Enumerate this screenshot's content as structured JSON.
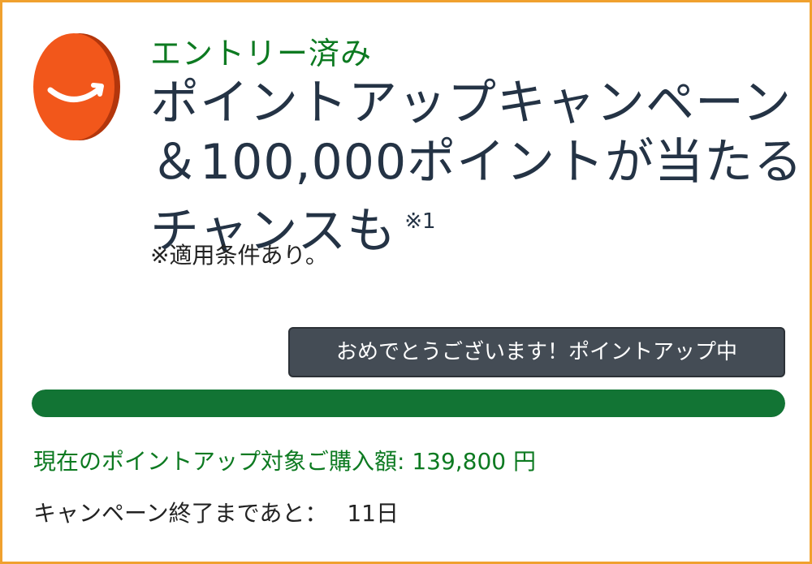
{
  "entry_status": "エントリー済み",
  "title_lines": [
    "ポイントアップキャンペーン",
    "＆100,000ポイントが当たる",
    "チャンスも"
  ],
  "title_footnote_mark": "※1",
  "terms_note": "※適用条件あり。",
  "congrats_banner": "おめでとうございます！ポイントアップ中",
  "progress": {
    "fraction": 1.0
  },
  "purchase_amount_text": "現在のポイントアップ対象ご購入額: 139,800 円",
  "campaign_end_label": "キャンペーン終了まであと：",
  "campaign_days_left": "11日",
  "icons": {
    "logo": "amazon-smile-coin-icon"
  },
  "colors": {
    "border": "#f0a12e",
    "coin": "#f2571b",
    "status_green": "#0d7a21",
    "title": "#243345",
    "banner_bg": "#444c55",
    "progress_fill": "#127434"
  }
}
